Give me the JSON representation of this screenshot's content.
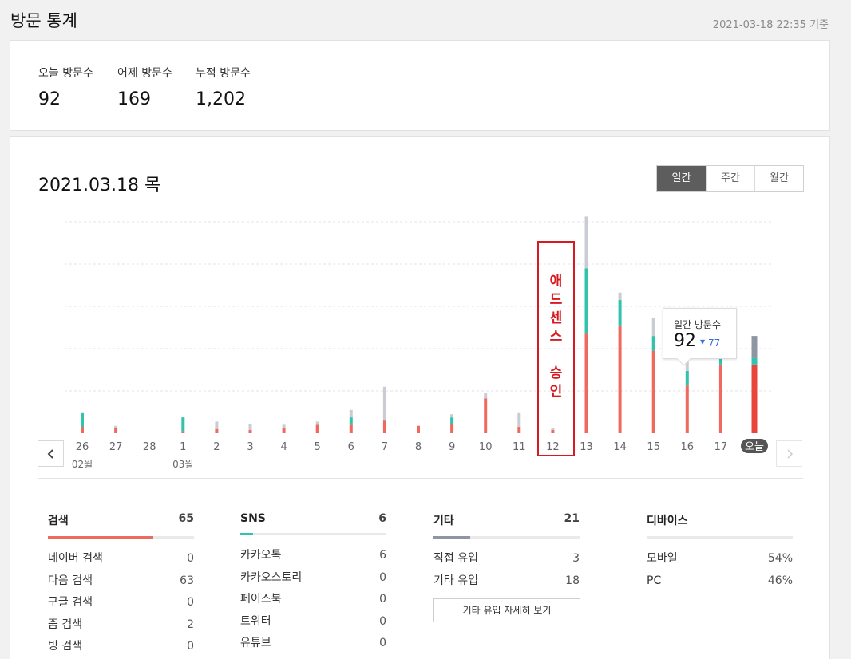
{
  "header": {
    "title": "방문 통계",
    "updated": "2021-03-18 22:35 기준"
  },
  "summary": [
    {
      "label": "오늘 방문수",
      "value": "92"
    },
    {
      "label": "어제 방문수",
      "value": "169"
    },
    {
      "label": "누적 방문수",
      "value": "1,202"
    }
  ],
  "main": {
    "date_title": "2021.03.18 목",
    "tabs": [
      {
        "label": "일간"
      },
      {
        "label": "주간"
      },
      {
        "label": "월간"
      }
    ],
    "prev_icon": "chevron-left-icon",
    "next_icon": "chevron-right-icon",
    "annotation": [
      "애",
      "드",
      "센",
      "스",
      "",
      "승",
      "인"
    ]
  },
  "tooltip": {
    "label": "일간 방문수",
    "value": "92",
    "prev": "77"
  },
  "colors": {
    "search": "#ef6a5e",
    "search_today": "#e8463c",
    "sns": "#33c2ad",
    "other": "#c9cdd3",
    "other_today": "#8e95a3",
    "accent": "#d71920"
  },
  "chart_data": {
    "type": "bar",
    "stacked": true,
    "categories": [
      "26",
      "27",
      "28",
      "1",
      "2",
      "3",
      "4",
      "5",
      "6",
      "7",
      "8",
      "9",
      "10",
      "11",
      "12",
      "13",
      "14",
      "15",
      "16",
      "17",
      "오늘"
    ],
    "month_labels": [
      {
        "index": 0,
        "text": "02월"
      },
      {
        "index": 3,
        "text": "03월"
      }
    ],
    "series": [
      {
        "key": "search",
        "values": [
          6,
          5,
          0,
          2,
          4,
          3,
          5,
          8,
          8,
          12,
          7,
          9,
          33,
          6,
          3,
          94,
          102,
          78,
          45,
          65,
          65
        ]
      },
      {
        "key": "sns",
        "values": [
          13,
          0,
          0,
          13,
          0,
          0,
          0,
          0,
          7,
          0,
          0,
          6,
          0,
          0,
          0,
          62,
          24,
          14,
          14,
          14,
          6
        ]
      },
      {
        "key": "other",
        "values": [
          0,
          2,
          0,
          0,
          7,
          6,
          3,
          3,
          7,
          32,
          0,
          3,
          5,
          13,
          2,
          49,
          7,
          17,
          20,
          35,
          21
        ]
      }
    ],
    "ylim": [
      0,
      200
    ],
    "grid": true
  },
  "sources": [
    {
      "title": "검색",
      "total": "65",
      "ratio": 0.72,
      "color": "#ef6a5e",
      "items": [
        {
          "label": "네이버 검색",
          "value": "0"
        },
        {
          "label": "다음 검색",
          "value": "63"
        },
        {
          "label": "구글 검색",
          "value": "0"
        },
        {
          "label": "줌 검색",
          "value": "2"
        },
        {
          "label": "빙 검색",
          "value": "0"
        }
      ]
    },
    {
      "title": "SNS",
      "total": "6",
      "ratio": 0.09,
      "color": "#33c2ad",
      "items": [
        {
          "label": "카카오톡",
          "value": "6"
        },
        {
          "label": "카카오스토리",
          "value": "0"
        },
        {
          "label": "페이스북",
          "value": "0"
        },
        {
          "label": "트위터",
          "value": "0"
        },
        {
          "label": "유튜브",
          "value": "0"
        }
      ]
    },
    {
      "title": "기타",
      "total": "21",
      "ratio": 0.25,
      "color": "#8e95a3",
      "items": [
        {
          "label": "직접 유입",
          "value": "3"
        },
        {
          "label": "기타 유입",
          "value": "18"
        }
      ],
      "button": "기타 유입 자세히 보기"
    },
    {
      "title": "디바이스",
      "total": "",
      "ratio": 0,
      "color": "#e9e9e9",
      "items": [
        {
          "label": "모바일",
          "value": "54%"
        },
        {
          "label": "PC",
          "value": "46%"
        }
      ]
    }
  ]
}
